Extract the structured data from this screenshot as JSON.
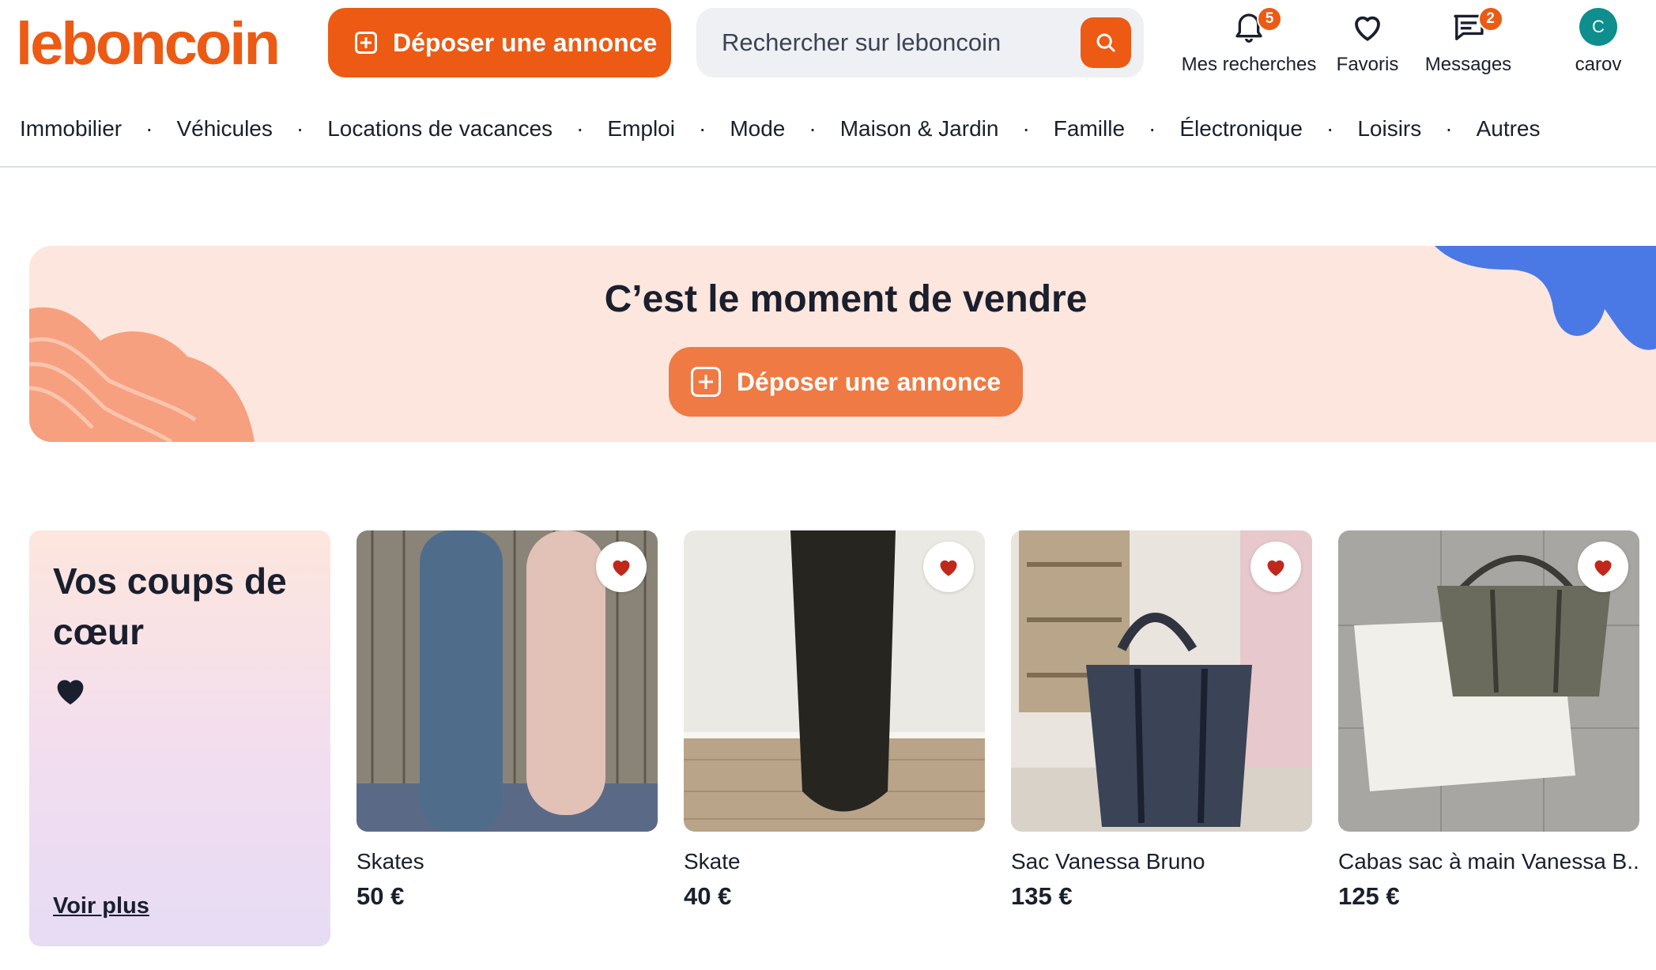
{
  "header": {
    "logo": "leboncoin",
    "post_button": "Déposer une annonce",
    "search_placeholder": "Rechercher sur leboncoin",
    "nav": [
      {
        "label": "Mes recherches",
        "icon": "bell-icon",
        "badge": "5"
      },
      {
        "label": "Favoris",
        "icon": "heart-icon"
      },
      {
        "label": "Messages",
        "icon": "messages-icon",
        "badge": "2"
      },
      {
        "label": "carov",
        "icon": "avatar",
        "avatar_letter": "C"
      }
    ]
  },
  "categories": [
    "Immobilier",
    "Véhicules",
    "Locations de vacances",
    "Emploi",
    "Mode",
    "Maison & Jardin",
    "Famille",
    "Électronique",
    "Loisirs",
    "Autres"
  ],
  "banner": {
    "title": "C’est le moment de vendre",
    "button": "Déposer une annonce"
  },
  "favorites": {
    "title": "Vos coups de cœur",
    "more_link": "Voir plus",
    "items": [
      {
        "title": "Skates",
        "price": "50 €"
      },
      {
        "title": "Skate",
        "price": "40 €"
      },
      {
        "title": "Sac Vanessa Bruno",
        "price": "135 €"
      },
      {
        "title": "Cabas sac à main Vanessa B...",
        "price": "125 €"
      }
    ]
  },
  "colors": {
    "brand_orange": "#ec5a13",
    "banner_bg": "#fde6dd",
    "avatar_teal": "#0e8e8c",
    "heart_red": "#c0281b"
  }
}
